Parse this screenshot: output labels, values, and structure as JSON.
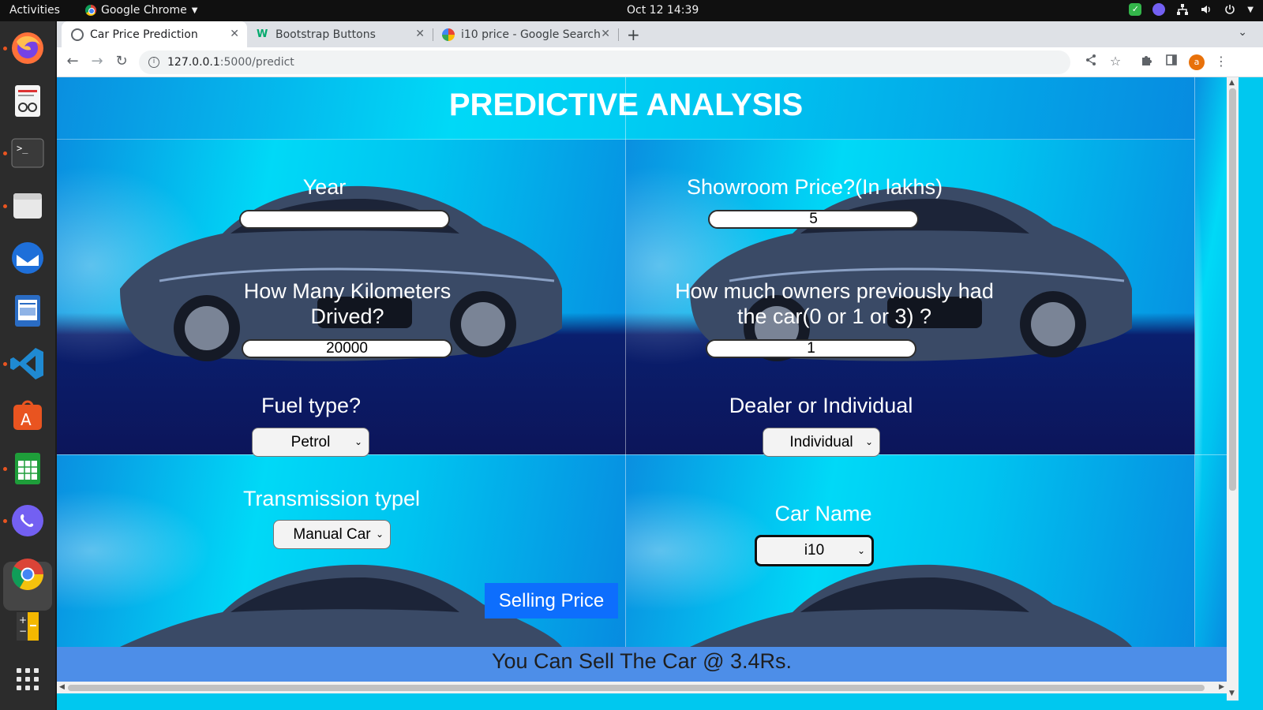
{
  "system_bar": {
    "activities": "Activities",
    "app_name": "Google Chrome",
    "clock": "Oct 12  14:39"
  },
  "dock": {
    "apps": [
      "firefox-icon",
      "document-viewer-icon",
      "terminal-icon",
      "files-icon",
      "thunderbird-icon",
      "writer-icon",
      "vscode-icon",
      "software-center-icon",
      "calc-icon",
      "viber-icon",
      "chrome-icon",
      "calculator-icon",
      "show-apps-icon"
    ]
  },
  "browser": {
    "tabs": [
      {
        "title": "Car Price Prediction",
        "active": true
      },
      {
        "title": "Bootstrap Buttons",
        "active": false
      },
      {
        "title": "i10 price - Google Search",
        "active": false
      }
    ],
    "url_host": "127.0.0.1",
    "url_path": ":5000/predict",
    "profile_initial": "a"
  },
  "page": {
    "heading": "PREDICTIVE ANALYSIS",
    "fields": {
      "year": {
        "label": "Year",
        "value": ""
      },
      "showroom_price": {
        "label": "Showroom Price?(In lakhs)",
        "value": "5"
      },
      "kms_driven": {
        "label_line1": "How Many Kilometers",
        "label_line2": "Drived?",
        "value": "20000"
      },
      "owners": {
        "label_line1": "How much owners previously had",
        "label_line2": "the car(0 or 1 or 3) ?",
        "value": "1"
      },
      "fuel_type": {
        "label": "Fuel type?",
        "selected": "Petrol"
      },
      "seller_type": {
        "label": "Dealer or Individual",
        "selected": "Individual"
      },
      "transmission": {
        "label": "Transmission typel",
        "selected": "Manual Car"
      },
      "car_name": {
        "label": "Car Name",
        "selected": "i10"
      }
    },
    "submit_label": "Selling Price",
    "result_text": "You Can Sell The Car @ 3.4Rs."
  },
  "colors": {
    "page_bg": "#00c8ef",
    "button": "#0d6efd",
    "result_bar": "#4d8ee8"
  }
}
